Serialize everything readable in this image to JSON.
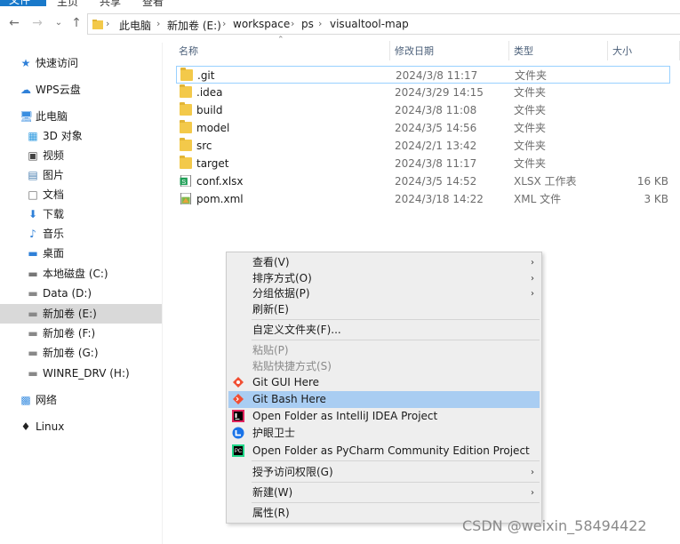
{
  "ribbon": {
    "tabs": [
      "文件",
      "主页",
      "共享",
      "查看"
    ]
  },
  "address": {
    "crumbs": [
      "此电脑",
      "新加卷 (E:)",
      "workspace",
      "ps",
      "visualtool-map"
    ]
  },
  "sidebar": {
    "items": [
      {
        "label": "快速访问",
        "icon": "star-icon"
      },
      {
        "label": "WPS云盘",
        "icon": "cloud-icon"
      },
      {
        "label": "此电脑",
        "icon": "computer-icon"
      },
      {
        "label": "3D 对象",
        "icon": "cube-icon"
      },
      {
        "label": "视频",
        "icon": "video-icon"
      },
      {
        "label": "图片",
        "icon": "picture-icon"
      },
      {
        "label": "文档",
        "icon": "document-icon"
      },
      {
        "label": "下载",
        "icon": "download-icon"
      },
      {
        "label": "音乐",
        "icon": "music-icon"
      },
      {
        "label": "桌面",
        "icon": "desktop-icon"
      },
      {
        "label": "本地磁盘 (C:)",
        "icon": "windows-drive-icon"
      },
      {
        "label": "Data (D:)",
        "icon": "drive-icon"
      },
      {
        "label": "新加卷 (E:)",
        "icon": "drive-icon"
      },
      {
        "label": "新加卷 (F:)",
        "icon": "drive-icon"
      },
      {
        "label": "新加卷 (G:)",
        "icon": "drive-icon"
      },
      {
        "label": "WINRE_DRV (H:)",
        "icon": "drive-icon"
      },
      {
        "label": "网络",
        "icon": "network-icon"
      },
      {
        "label": "Linux",
        "icon": "linux-penguin-icon"
      }
    ]
  },
  "columns": [
    "名称",
    "修改日期",
    "类型",
    "大小"
  ],
  "files": [
    {
      "name": ".git",
      "date": "2024/3/8 11:17",
      "type": "文件夹",
      "size": "",
      "icon": "folder-icon"
    },
    {
      "name": ".idea",
      "date": "2024/3/29 14:15",
      "type": "文件夹",
      "size": "",
      "icon": "folder-icon"
    },
    {
      "name": "build",
      "date": "2024/3/8 11:08",
      "type": "文件夹",
      "size": "",
      "icon": "folder-icon"
    },
    {
      "name": "model",
      "date": "2024/3/5 14:56",
      "type": "文件夹",
      "size": "",
      "icon": "folder-icon"
    },
    {
      "name": "src",
      "date": "2024/2/1 13:42",
      "type": "文件夹",
      "size": "",
      "icon": "folder-icon"
    },
    {
      "name": "target",
      "date": "2024/3/8 11:17",
      "type": "文件夹",
      "size": "",
      "icon": "folder-icon"
    },
    {
      "name": "conf.xlsx",
      "date": "2024/3/5 14:52",
      "type": "XLSX 工作表",
      "size": "16 KB",
      "icon": "spreadsheet-icon"
    },
    {
      "name": "pom.xml",
      "date": "2024/3/18 14:22",
      "type": "XML 文件",
      "size": "3 KB",
      "icon": "xml-file-icon"
    }
  ],
  "context_menu": {
    "view": "查看(V)",
    "sort": "排序方式(O)",
    "group": "分组依据(P)",
    "refresh": "刷新(E)",
    "customize": "自定义文件夹(F)...",
    "paste": "粘贴(P)",
    "paste_shortcut": "粘贴快捷方式(S)",
    "git_gui": "Git GUI Here",
    "git_bash": "Git Bash Here",
    "intellij": "Open Folder as IntelliJ IDEA Project",
    "guard": "护眼卫士",
    "pycharm": "Open Folder as PyCharm Community Edition Project",
    "grant_access": "授予访问权限(G)",
    "new": "新建(W)",
    "properties": "属性(R)"
  },
  "colors": {
    "selected_menu": "#a9cdf2",
    "menu_bg": "#eeeeee",
    "folder": "#f3c94a",
    "sidebar_selected": "#d9d9d9"
  },
  "watermark": "CSDN @weixin_58494422"
}
